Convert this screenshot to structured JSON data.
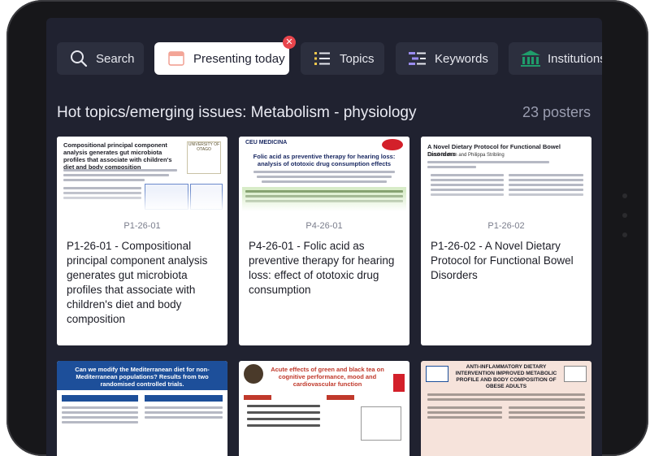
{
  "toolbar": {
    "search": {
      "label": "Search",
      "icon": "search-icon"
    },
    "presenting": {
      "label": "Presenting today",
      "icon": "calendar-icon",
      "clear_icon": "close-icon"
    },
    "topics": {
      "label": "Topics",
      "icon": "list-icon"
    },
    "keywords": {
      "label": "Keywords",
      "icon": "keyword-list-icon"
    },
    "institutions": {
      "label": "Institutions",
      "icon": "institution-icon"
    }
  },
  "section": {
    "title": "Hot topics/emerging issues: Metabolism  - physiology",
    "count": "23 posters"
  },
  "posters": [
    {
      "code": "P1-26-01",
      "title": "P1-26-01 - Compositional principal component analysis generates gut microbiota profiles that associate with children's diet and body composition",
      "thumb_title": "Compositional principal component analysis generates gut microbiota profiles that associate with children's diet and body composition",
      "thumb_logo": "UNIVERSITY OF OTAGO"
    },
    {
      "code": "P4-26-01",
      "title": "P4-26-01 - Folic acid as preventive therapy for hearing loss: effect of ototoxic drug consumption",
      "thumb_title": "Folic acid as preventive therapy for hearing loss: analysis of ototoxic drug consumption effects",
      "thumb_logo": "CEU MEDICINA"
    },
    {
      "code": "P1-26-02",
      "title": "P1-26-02 - A Novel Dietary Protocol for Functional Bowel Disorders",
      "thumb_title": "A Novel Dietary Protocol for Functional Bowel Disorders",
      "thumb_authors": "Fandi Ibrahim and Philippa Stribling"
    }
  ],
  "bottom_posters": [
    {
      "thumb_title": "Can we modify the Mediterranean diet for non-Mediterranean populations? Results from two randomised controlled trials."
    },
    {
      "thumb_title": "Acute effects of green and black tea on cognitive performance, mood and cardiovascular function"
    },
    {
      "thumb_title": "ANTI-INFLAMMATORY DIETARY INTERVENTION IMPROVED METABOLIC PROFILE AND BODY COMPOSITION OF OBESE ADULTS"
    }
  ],
  "colors": {
    "screen_bg": "#202230",
    "button_bg": "#2c2f3e",
    "accent_red": "#e8454c",
    "institution_green": "#1f9d6b",
    "keyword_purple": "#9a8cf0",
    "topics_yellow": "#f2c94c"
  }
}
